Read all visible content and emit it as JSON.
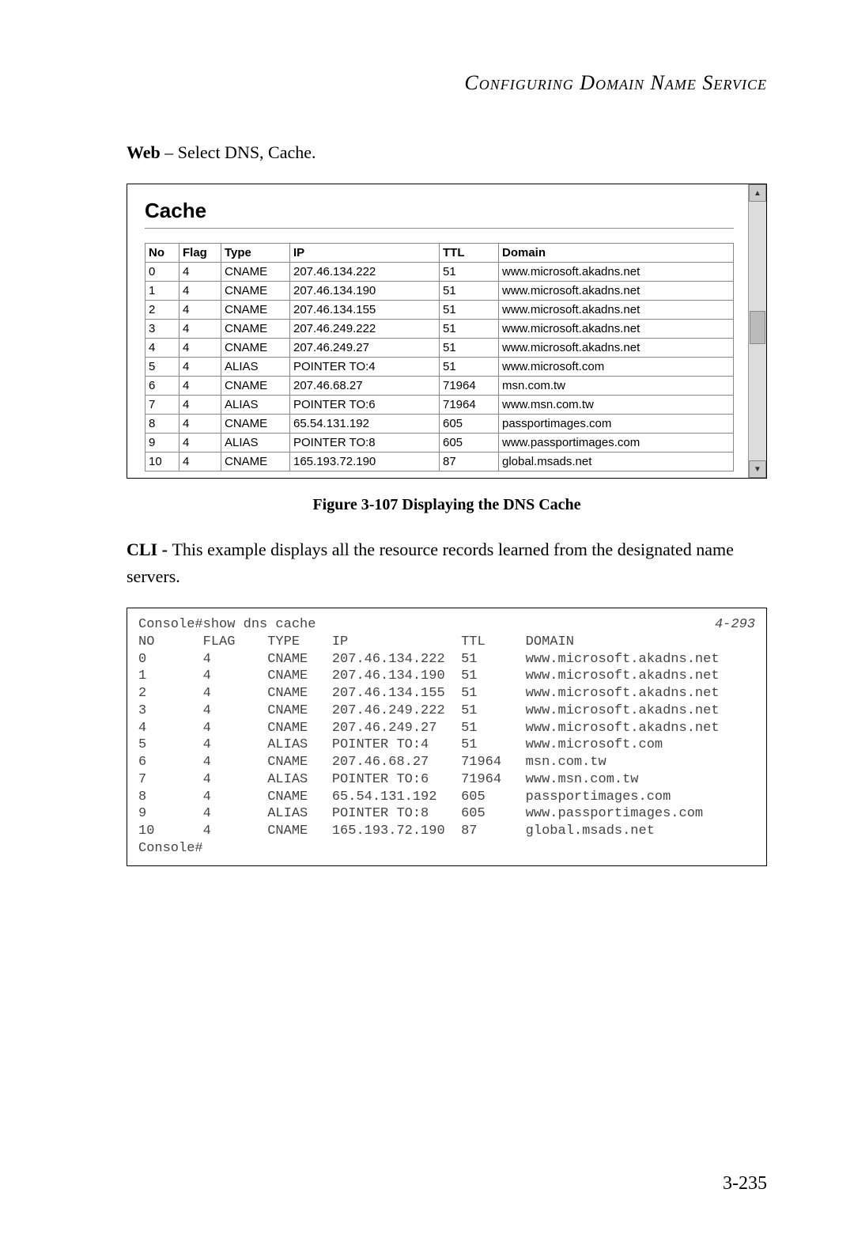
{
  "header": {
    "title": "Configuring Domain Name Service"
  },
  "web_line": {
    "prefix": "Web",
    "rest": " – Select DNS, Cache."
  },
  "screenshot": {
    "title": "Cache",
    "headers": {
      "no": "No",
      "flag": "Flag",
      "type": "Type",
      "ip": "IP",
      "ttl": "TTL",
      "domain": "Domain"
    },
    "rows": [
      {
        "no": "0",
        "flag": "4",
        "type": "CNAME",
        "ip": "207.46.134.222",
        "ttl": "51",
        "domain": "www.microsoft.akadns.net"
      },
      {
        "no": "1",
        "flag": "4",
        "type": "CNAME",
        "ip": "207.46.134.190",
        "ttl": "51",
        "domain": "www.microsoft.akadns.net"
      },
      {
        "no": "2",
        "flag": "4",
        "type": "CNAME",
        "ip": "207.46.134.155",
        "ttl": "51",
        "domain": "www.microsoft.akadns.net"
      },
      {
        "no": "3",
        "flag": "4",
        "type": "CNAME",
        "ip": "207.46.249.222",
        "ttl": "51",
        "domain": "www.microsoft.akadns.net"
      },
      {
        "no": "4",
        "flag": "4",
        "type": "CNAME",
        "ip": "207.46.249.27",
        "ttl": "51",
        "domain": "www.microsoft.akadns.net"
      },
      {
        "no": "5",
        "flag": "4",
        "type": "ALIAS",
        "ip": "POINTER TO:4",
        "ttl": "51",
        "domain": "www.microsoft.com"
      },
      {
        "no": "6",
        "flag": "4",
        "type": "CNAME",
        "ip": "207.46.68.27",
        "ttl": "71964",
        "domain": "msn.com.tw"
      },
      {
        "no": "7",
        "flag": "4",
        "type": "ALIAS",
        "ip": "POINTER TO:6",
        "ttl": "71964",
        "domain": "www.msn.com.tw"
      },
      {
        "no": "8",
        "flag": "4",
        "type": "CNAME",
        "ip": "65.54.131.192",
        "ttl": "605",
        "domain": "passportimages.com"
      },
      {
        "no": "9",
        "flag": "4",
        "type": "ALIAS",
        "ip": "POINTER TO:8",
        "ttl": "605",
        "domain": "www.passportimages.com"
      },
      {
        "no": "10",
        "flag": "4",
        "type": "CNAME",
        "ip": "165.193.72.190",
        "ttl": "87",
        "domain": "global.msads.net"
      }
    ],
    "scroll_up": "▲",
    "scroll_down": "▼"
  },
  "figure_caption": "Figure 3-107   Displaying the DNS Cache",
  "cli_line": {
    "prefix": "CLI - ",
    "rest": "This example displays all the resource records learned from the designated name servers."
  },
  "cli_box": {
    "ref": "4-293",
    "cmd": "Console#show dns cache",
    "hdr": "NO      FLAG    TYPE    IP              TTL     DOMAIN",
    "rows": [
      "0       4       CNAME   207.46.134.222  51      www.microsoft.akadns.net",
      "1       4       CNAME   207.46.134.190  51      www.microsoft.akadns.net",
      "2       4       CNAME   207.46.134.155  51      www.microsoft.akadns.net",
      "3       4       CNAME   207.46.249.222  51      www.microsoft.akadns.net",
      "4       4       CNAME   207.46.249.27   51      www.microsoft.akadns.net",
      "5       4       ALIAS   POINTER TO:4    51      www.microsoft.com",
      "6       4       CNAME   207.46.68.27    71964   msn.com.tw",
      "7       4       ALIAS   POINTER TO:6    71964   www.msn.com.tw",
      "8       4       CNAME   65.54.131.192   605     passportimages.com",
      "9       4       ALIAS   POINTER TO:8    605     www.passportimages.com",
      "10      4       CNAME   165.193.72.190  87      global.msads.net"
    ],
    "prompt": "Console#"
  },
  "page_number": "3-235"
}
